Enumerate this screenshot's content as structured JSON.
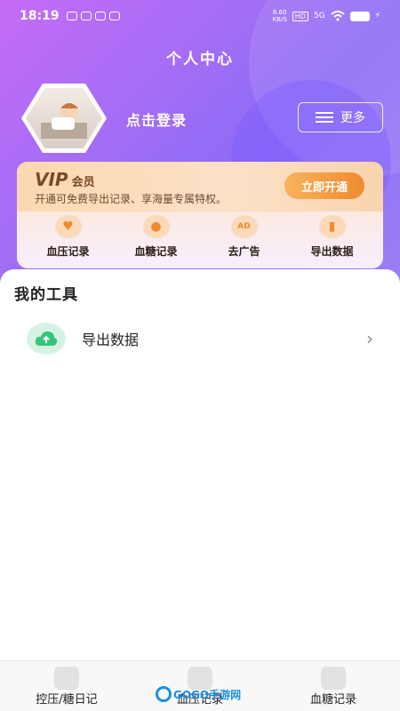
{
  "status_bar": {
    "time": "18:19",
    "net_rate": "8.60\nKB/S",
    "hd": "HD",
    "signal": "5G"
  },
  "header": {
    "title": "个人中心"
  },
  "profile": {
    "login_text": "点击登录",
    "more_label": "更多"
  },
  "vip": {
    "logo": "VIP",
    "title_suffix": "会员",
    "description": "开通可免费导出记录、享海量专属特权。",
    "activate_label": "立即开通",
    "features": [
      {
        "label": "血压记录",
        "icon": "heart-wave-icon"
      },
      {
        "label": "血糖记录",
        "icon": "blood-drop-icon"
      },
      {
        "label": "去广告",
        "icon": "ad-icon"
      },
      {
        "label": "导出数据",
        "icon": "bar-chart-icon"
      }
    ]
  },
  "tools": {
    "section_title": "我的工具",
    "items": [
      {
        "label": "导出数据",
        "icon": "cloud-upload-icon"
      }
    ]
  },
  "tab_bar": {
    "tabs": [
      {
        "label": "控压/糖日记",
        "icon": "diary-icon"
      },
      {
        "label": "血压记录",
        "icon": "blood-pressure-icon"
      },
      {
        "label": "血糖记录",
        "icon": "blood-sugar-icon"
      }
    ]
  },
  "watermark": {
    "text": "GOGO手游网"
  },
  "colors": {
    "header_gradient_start": "#c66cf7",
    "header_gradient_end": "#8c6cf6",
    "vip_button": "#f08a2f",
    "tool_icon_bg": "#d5f3e3",
    "tool_icon_fg": "#35c47a"
  }
}
